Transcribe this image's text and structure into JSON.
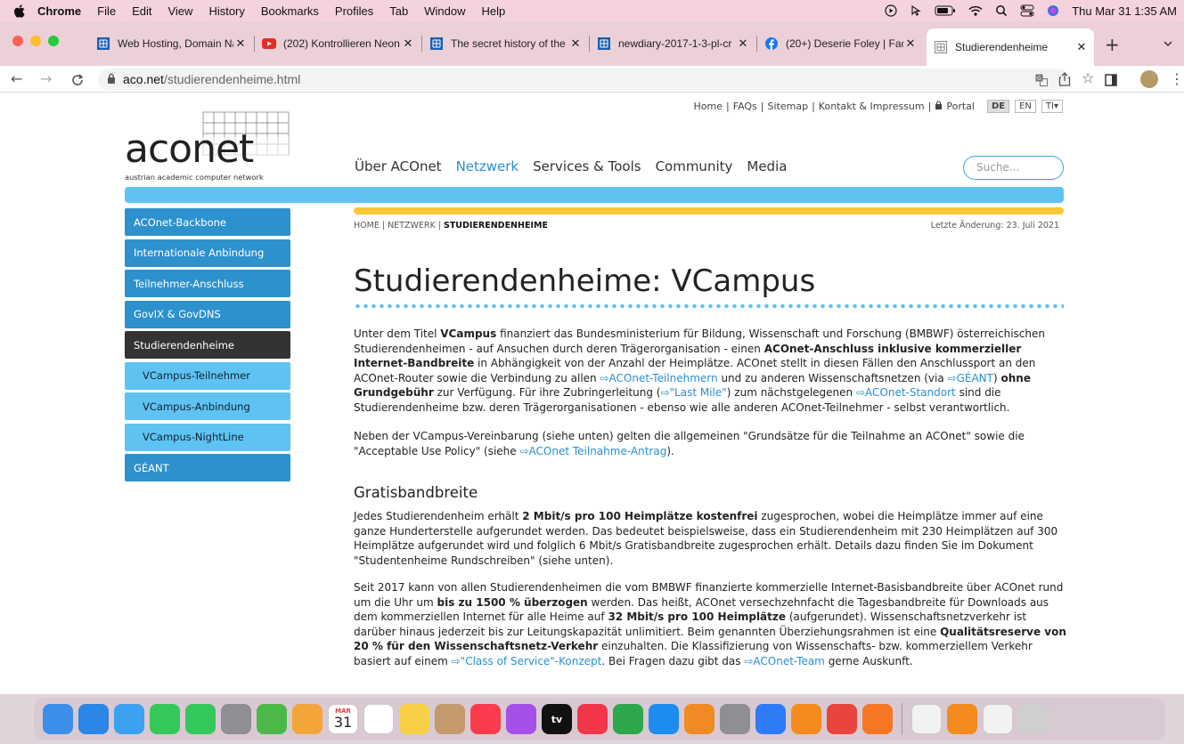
{
  "menubar": {
    "app_name": "Chrome",
    "items": [
      "File",
      "Edit",
      "View",
      "History",
      "Bookmarks",
      "Profiles",
      "Tab",
      "Window",
      "Help"
    ],
    "clock": "Thu Mar 31  1:35 AM"
  },
  "tabs": [
    {
      "title": "Web Hosting, Domain Na",
      "icon": "grid-icon",
      "color": "#1a5fb4"
    },
    {
      "title": "(202) Kontrollieren Neon",
      "icon": "youtube-icon",
      "color": "#e52d27"
    },
    {
      "title": "The secret history of the",
      "icon": "grid-icon",
      "color": "#1a5fb4"
    },
    {
      "title": "newdiary-2017-1-3-pl-cr",
      "icon": "grid-icon",
      "color": "#1a5fb4"
    },
    {
      "title": "(20+) Deserie Foley | Fac",
      "icon": "facebook-icon",
      "color": "#1877f2"
    },
    {
      "title": "Studierendenheime",
      "icon": "grid-icon",
      "color": "#888888",
      "active": true
    }
  ],
  "address": {
    "host": "aco.net",
    "path": "/studierendenheime.html"
  },
  "site": {
    "top_links": [
      "Home",
      "FAQs",
      "Sitemap",
      "Kontakt & Impressum"
    ],
    "portal": "Portal",
    "lang_de": "DE",
    "lang_en": "EN",
    "font_toggle": "TI",
    "logo_text": "aconet",
    "logo_tagline": "austrian academic computer network",
    "nav": [
      "Über ACOnet",
      "Netzwerk",
      "Services & Tools",
      "Community",
      "Media"
    ],
    "search_placeholder": "Suche...",
    "accent_blue": "#2d91cd",
    "light_blue": "#5ec3f2",
    "yellow": "#f9c837"
  },
  "sidebar": [
    {
      "label": "ACOnet-Backbone",
      "type": "main"
    },
    {
      "label": "Internationale Anbindung",
      "type": "main"
    },
    {
      "label": "Teilnehmer-Anschluss",
      "type": "main"
    },
    {
      "label": "GovIX & GovDNS",
      "type": "main"
    },
    {
      "label": "Studierendenheime",
      "type": "active"
    },
    {
      "label": "VCampus-Teilnehmer",
      "type": "sub"
    },
    {
      "label": "VCampus-Anbindung",
      "type": "sub"
    },
    {
      "label": "VCampus-NightLine",
      "type": "sub"
    },
    {
      "label": "GÉANT",
      "type": "main"
    }
  ],
  "breadcrumb": {
    "home": "HOME",
    "section": "NETZWERK",
    "current": "STUDIERENDENHEIME"
  },
  "last_change": "Letzte Änderung: 23. Juli 2021",
  "title": "Studierendenheime: VCampus",
  "content": {
    "p1_a": "Unter dem Titel ",
    "p1_b": "VCampus",
    "p1_c": " finanziert das Bundesministerium für Bildung, Wissenschaft und Forschung (BMBWF) österreichischen Studierendenheimen - auf Ansuchen durch deren Trägerorganisation - einen ",
    "p1_d": "ACOnet-Anschluss inklusive kommerzieller Internet-Bandbreite",
    "p1_e": " in Abhängigkeit von der Anzahl der Heimplätze. ACOnet stellt in diesen Fällen den Anschlussport an den ACOnet-Router sowie die Verbindung zu allen ",
    "p1_link1": "ACOnet-Teilnehmern",
    "p1_f": " und zu anderen Wissenschaftsnetzen (via ",
    "p1_link2": "GÉANT",
    "p1_g": ") ",
    "p1_h": "ohne Grundgebühr",
    "p1_i": " zur Verfügung. Für ihre Zubringerleitung (",
    "p1_link3": "\"Last Mile\"",
    "p1_j": ") zum nächstgelegenen ",
    "p1_link4": "ACOnet-Standort",
    "p1_k": " sind die Studierendenheime bzw. deren Trägerorganisationen - ebenso wie alle anderen ACOnet-Teilnehmer - selbst verantwortlich.",
    "p2_a": "Neben der VCampus-Vereinbarung (siehe unten) gelten die allgemeinen \"Grundsätze für die Teilnahme an ACOnet\" sowie die \"Acceptable Use Policy\" (siehe ",
    "p2_link": "ACOnet Teilnahme-Antrag",
    "p2_b": ").",
    "h2": "Gratisbandbreite",
    "p3_a": "Jedes Studierendenheim erhält ",
    "p3_b": "2 Mbit/s pro 100 Heimplätze kostenfrei",
    "p3_c": " zugesprochen, wobei die Heimplätze immer auf eine ganze Hunderterstelle aufgerundet werden. Das bedeutet beispielsweise, dass ein Studierendenheim mit 230 Heimplätzen auf 300 Heimplätze aufgerundet wird und folglich 6 Mbit/s Gratisbandbreite zugesprochen erhält. Details dazu finden Sie im Dokument \"Studentenheime Rundschreiben\" (siehe unten).",
    "p4_a": "Seit 2017 kann von allen Studierendenheimen die vom BMBWF finanzierte kommerzielle Internet-Basisbandbreite über ACOnet rund um die Uhr um ",
    "p4_b": "bis zu 1500 % überzogen",
    "p4_c": " werden. Das heißt, ACOnet versechzehnfacht die Tagesbandbreite für Downloads aus dem kommerziellen Internet für alle Heime auf ",
    "p4_d": "32 Mbit/s pro 100 Heimplätze",
    "p4_e": " (aufgerundet). Wissenschaftsnetzverkehr ist darüber hinaus jederzeit bis zur Leitungskapazität unlimitiert. Beim genannten Überziehungsrahmen ist eine ",
    "p4_f": "Qualitätsreserve von 20 % für den Wissenschaftsnetz-Verkehr",
    "p4_g": " einzuhalten. Die Klassifizierung von Wissenschafts- bzw. kommerziellem Verkehr basiert auf einem ",
    "p4_link1": "\"Class of Service\"-Konzept",
    "p4_h": ". Bei Fragen dazu gibt das ",
    "p4_link2": "ACOnet-Team",
    "p4_i": " gerne Auskunft."
  },
  "dock": {
    "calendar_month": "MAR",
    "calendar_day": "31",
    "tv_label": "tv",
    "icons": [
      {
        "name": "finder-icon",
        "color": "#3b8fe8"
      },
      {
        "name": "safari-icon",
        "color": "#2b86e6"
      },
      {
        "name": "mail-icon",
        "color": "#3ba1f0"
      },
      {
        "name": "facetime-icon",
        "color": "#35c759"
      },
      {
        "name": "messages-icon",
        "color": "#34c759"
      },
      {
        "name": "launchpad-icon",
        "color": "#8e8e93"
      },
      {
        "name": "maps-icon",
        "color": "#4cb848"
      },
      {
        "name": "photos-icon",
        "color": "#f4a53a"
      },
      {
        "name": "calendar-icon",
        "color": "#ffffff"
      },
      {
        "name": "reminders-icon",
        "color": "#ffffff"
      },
      {
        "name": "notes-icon",
        "color": "#f7d046"
      },
      {
        "name": "contacts-icon",
        "color": "#c49a6c"
      },
      {
        "name": "music-icon",
        "color": "#fa3c4c"
      },
      {
        "name": "podcasts-icon",
        "color": "#a550e6"
      },
      {
        "name": "appletv-icon",
        "color": "#111111"
      },
      {
        "name": "news-icon",
        "color": "#f2364a"
      },
      {
        "name": "numbers-icon",
        "color": "#2ea84a"
      },
      {
        "name": "appstore-icon",
        "color": "#1d8cf0"
      },
      {
        "name": "pages-icon",
        "color": "#f08a24"
      },
      {
        "name": "system-preferences-icon",
        "color": "#8e8e93"
      },
      {
        "name": "keynote-icon",
        "color": "#2d7cf6"
      },
      {
        "name": "vlc-icon",
        "color": "#f48b1f"
      },
      {
        "name": "chrome-icon",
        "color": "#e8453c"
      },
      {
        "name": "firefox-icon",
        "color": "#f77623"
      }
    ],
    "right_icons": [
      {
        "name": "document-icon",
        "color": "#f2f2f2"
      },
      {
        "name": "books-icon",
        "color": "#f48b1f"
      },
      {
        "name": "textedit-icon",
        "color": "#f2f2f2"
      },
      {
        "name": "trash-icon",
        "color": "#cfcfcf"
      }
    ]
  }
}
